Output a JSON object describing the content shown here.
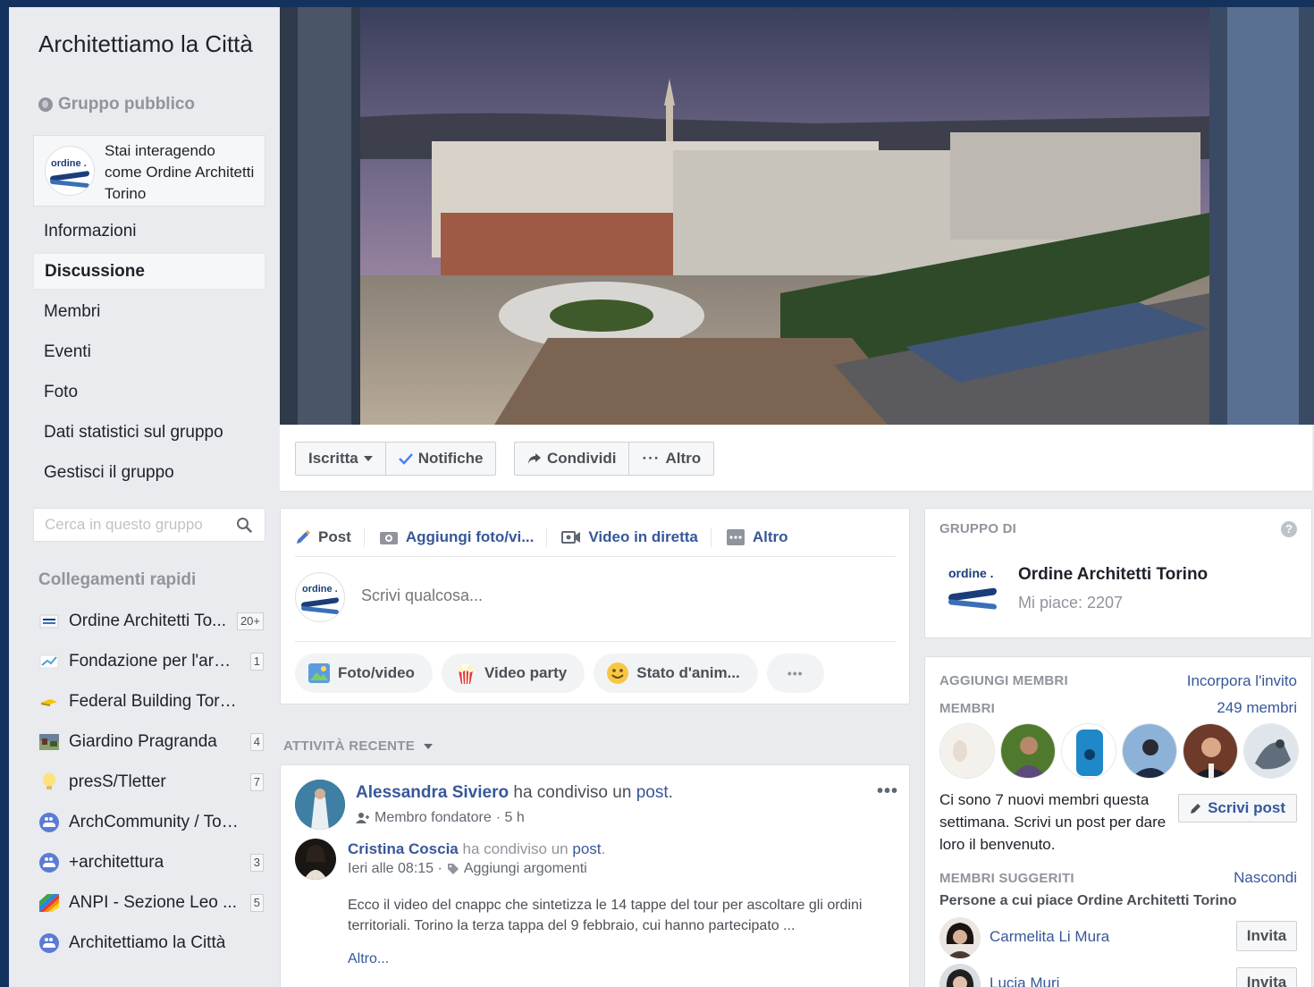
{
  "group": {
    "title": "Architettiamo la Città",
    "type": "Gruppo pubblico",
    "interacting_as": "Stai interagendo come Ordine Architetti Torino"
  },
  "nav": {
    "items": [
      {
        "label": "Informazioni"
      },
      {
        "label": "Discussione"
      },
      {
        "label": "Membri"
      },
      {
        "label": "Eventi"
      },
      {
        "label": "Foto"
      },
      {
        "label": "Dati statistici sul gruppo"
      },
      {
        "label": "Gestisci il gruppo"
      }
    ],
    "active": "Discussione"
  },
  "search": {
    "placeholder": "Cerca in questo gruppo"
  },
  "quick_links": {
    "title": "Collegamenti rapidi",
    "items": [
      {
        "label": "Ordine Architetti To...",
        "badge": "20+"
      },
      {
        "label": "Fondazione per l'arch...",
        "badge": "1"
      },
      {
        "label": "Federal Building Torino",
        "badge": ""
      },
      {
        "label": "Giardino Pragranda",
        "badge": "4"
      },
      {
        "label": "presS/Tletter",
        "badge": "7"
      },
      {
        "label": "ArchCommunity / Torino",
        "badge": ""
      },
      {
        "label": "+architettura",
        "badge": "3"
      },
      {
        "label": "ANPI - Sezione Leo ...",
        "badge": "5"
      },
      {
        "label": "Architettiamo la Città",
        "badge": ""
      }
    ]
  },
  "cover_actions": {
    "joined": "Iscritta",
    "notifications": "Notifiche",
    "share": "Condividi",
    "more": "Altro"
  },
  "composer": {
    "tabs": [
      "Post",
      "Aggiungi foto/vi...",
      "Video in diretta",
      "Altro"
    ],
    "placeholder": "Scrivi qualcosa...",
    "chips": [
      "Foto/video",
      "Video party",
      "Stato d'anim..."
    ],
    "more_dots": "•••"
  },
  "recent_activity": {
    "label": "ATTIVITÀ RECENTE"
  },
  "post": {
    "author": "Alessandra Siviero",
    "action": " ha condiviso un ",
    "object": "post",
    "dot": ".",
    "role": "Membro fondatore",
    "time": " · 5 h",
    "menu": "•••",
    "shared_author": "Cristina Coscia",
    "shared_action": " ha condiviso un ",
    "shared_object": "post",
    "shared_dot": ".",
    "shared_time": "Ieri alle 08:15 ·",
    "shared_topics": "Aggiungi argomenti",
    "text": "Ecco il video del cnappc che sintetizza le 14 tappe del tour per ascoltare gli ordini territoriali. Torino la terza tappa del 9 febbraio, cui hanno partecipato ...",
    "more": "Altro..."
  },
  "owner_card": {
    "title": "GRUPPO DI",
    "help": "?",
    "name": "Ordine Architetti Torino",
    "likes": "Mi piace: 2207"
  },
  "members_card": {
    "add_title": "AGGIUNGI MEMBRI",
    "embed_link": "Incorpora l'invito",
    "members_title": "MEMBRI",
    "members_count": "249 membri",
    "new_members_text": "Ci sono 7 nuovi membri questa settimana. Scrivi un post per dare loro il benvenuto.",
    "write_post": "Scrivi post",
    "suggested_title": "MEMBRI SUGGERITI",
    "hide": "Nascondi",
    "suggested_sub": "Persone a cui piace Ordine Architetti Torino",
    "suggested": [
      {
        "name": "Carmelita Li Mura",
        "button": "Invita"
      },
      {
        "name": "Lucia Muri",
        "button": "Invita"
      }
    ]
  },
  "colors": {
    "fb_blue": "#365899",
    "bg": "#e9ebee",
    "frame": "#14325e"
  }
}
